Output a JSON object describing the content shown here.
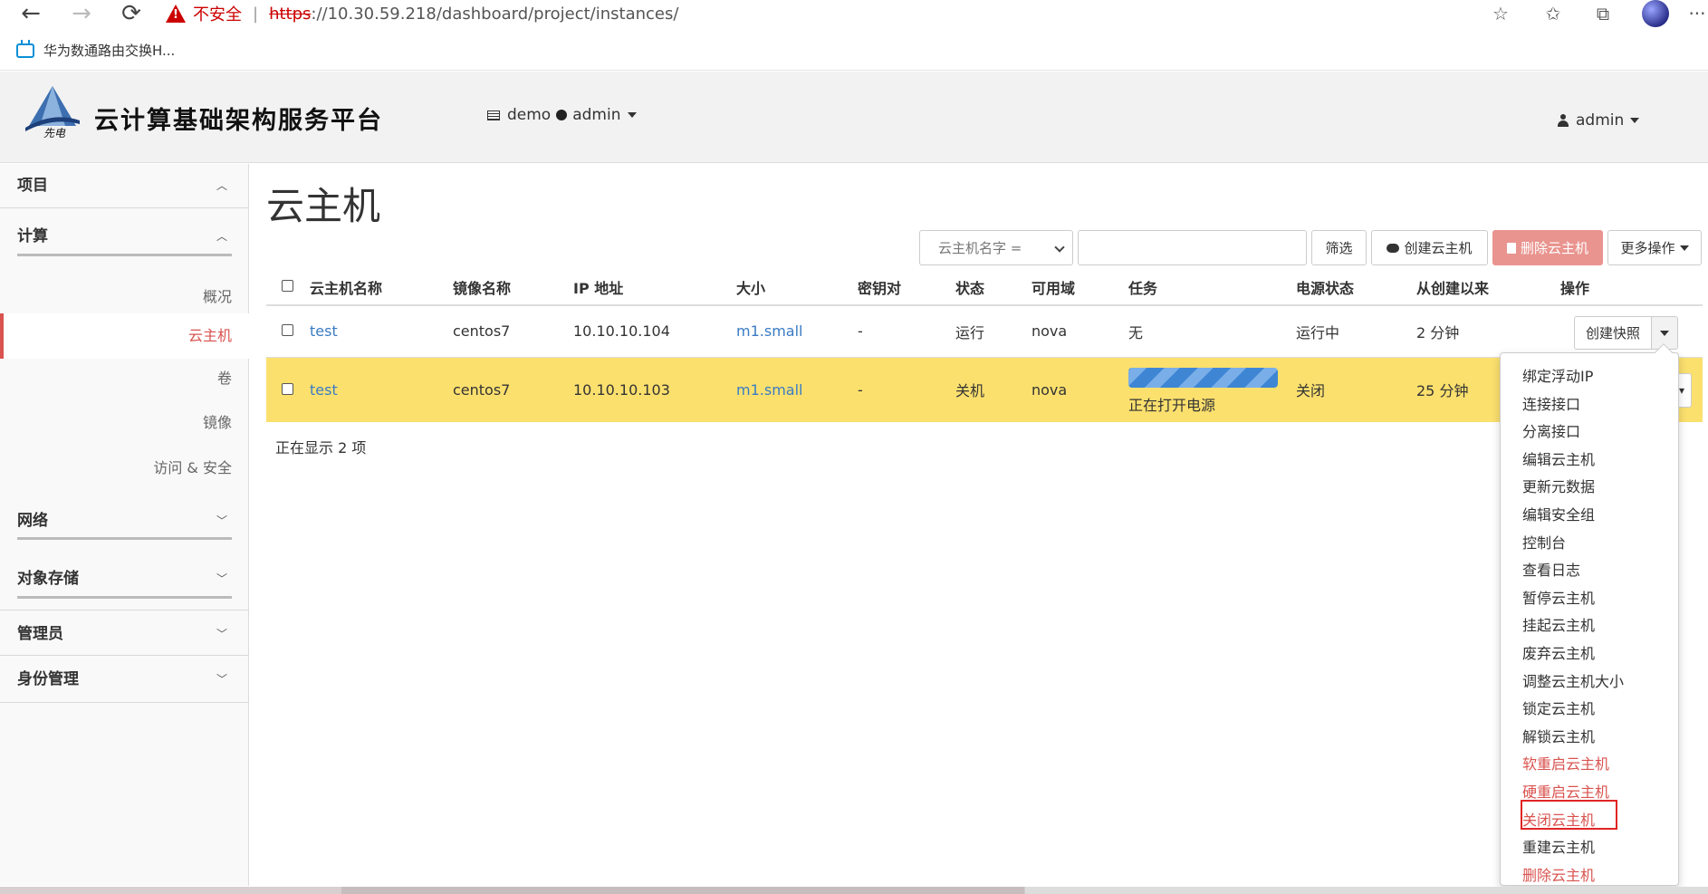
{
  "browser": {
    "back": "←",
    "forward": "→",
    "reload": "⟳",
    "security_label": "不安全",
    "url_scheme": "https",
    "url_rest": "://10.30.59.218/dashboard/project/instances/",
    "bookmark": "华为数通路由交换H...",
    "toolbar_icons": [
      "favorite-add-icon",
      "favorites-icon",
      "collections-icon",
      "profile-avatar",
      "more-icon"
    ],
    "more": "···"
  },
  "header": {
    "brand": "云计算基础架构服务平台",
    "project": "demo",
    "project_user": "admin",
    "user": "admin"
  },
  "sidebar": {
    "project": "项目",
    "compute": "计算",
    "compute_items": [
      "概况",
      "云主机",
      "卷",
      "镜像",
      "访问 & 安全"
    ],
    "active_item": "云主机",
    "network": "网络",
    "object_storage": "对象存储",
    "admin": "管理员",
    "identity": "身份管理"
  },
  "main": {
    "title": "云主机",
    "filter_select": "云主机名字 =",
    "filter_input": "",
    "filter_button": "筛选",
    "create_button": "创建云主机",
    "delete_button": "删除云主机",
    "more_button": "更多操作",
    "columns": [
      "云主机名称",
      "镜像名称",
      "IP 地址",
      "大小",
      "密钥对",
      "状态",
      "可用域",
      "任务",
      "电源状态",
      "从创建以来",
      "操作"
    ],
    "rows": [
      {
        "name": "test",
        "image": "centos7",
        "ip": "10.10.10.104",
        "size": "m1.small",
        "keypair": "-",
        "status": "运行",
        "zone": "nova",
        "task": "无",
        "power": "运行中",
        "age": "2 分钟",
        "action": "创建快照"
      },
      {
        "name": "test",
        "image": "centos7",
        "ip": "10.10.10.103",
        "size": "m1.small",
        "keypair": "-",
        "status": "关机",
        "zone": "nova",
        "task": "正在打开电源",
        "power": "关闭",
        "age": "25 分钟"
      }
    ],
    "count_text": "正在显示 2 项"
  },
  "dropdown": {
    "items": [
      {
        "label": "绑定浮动IP",
        "danger": false
      },
      {
        "label": "连接接口",
        "danger": false
      },
      {
        "label": "分离接口",
        "danger": false
      },
      {
        "label": "编辑云主机",
        "danger": false
      },
      {
        "label": "更新元数据",
        "danger": false
      },
      {
        "label": "编辑安全组",
        "danger": false
      },
      {
        "label": "控制台",
        "danger": false
      },
      {
        "label": "查看日志",
        "danger": false
      },
      {
        "label": "暂停云主机",
        "danger": false
      },
      {
        "label": "挂起云主机",
        "danger": false
      },
      {
        "label": "废弃云主机",
        "danger": false
      },
      {
        "label": "调整云主机大小",
        "danger": false
      },
      {
        "label": "锁定云主机",
        "danger": false
      },
      {
        "label": "解锁云主机",
        "danger": false
      },
      {
        "label": "软重启云主机",
        "danger": true
      },
      {
        "label": "硬重启云主机",
        "danger": true
      },
      {
        "label": "关闭云主机",
        "danger": true
      },
      {
        "label": "重建云主机",
        "danger": false
      },
      {
        "label": "删除云主机",
        "danger": true
      }
    ],
    "highlighted": "关闭云主机"
  },
  "colors": {
    "accent": "#d9534f",
    "link": "#3a7bc4",
    "highlight_row": "#fbe06e",
    "progress": "#3e86d4"
  }
}
